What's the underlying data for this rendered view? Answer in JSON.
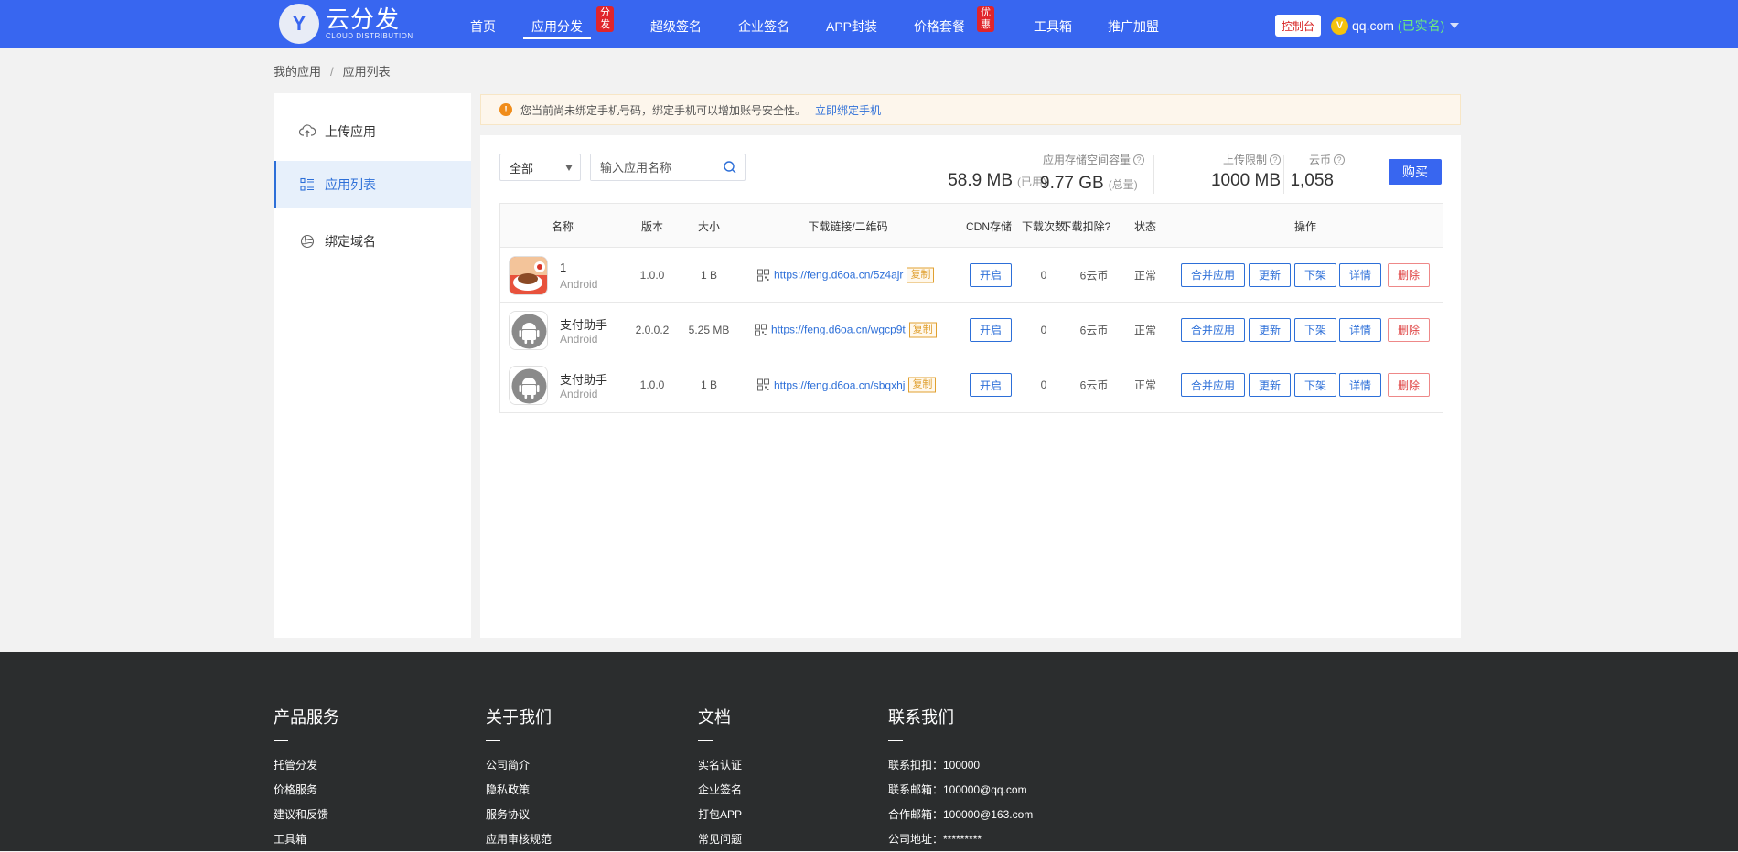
{
  "logo": {
    "badge": "Y",
    "name": "云分发",
    "subtitle": "CLOUD DISTRIBUTION"
  },
  "nav": {
    "items": [
      "首页",
      "应用分发",
      "超级签名",
      "企业签名",
      "APP封装",
      "价格套餐",
      "工具箱",
      "推广加盟"
    ],
    "active": "应用分发",
    "tags": {
      "distribute": "分发",
      "pricing": "优惠"
    }
  },
  "header": {
    "console_label": "控制台",
    "vip_badge": "V",
    "user_email": "qq.com",
    "verified_label": "(已实名)"
  },
  "breadcrumb": [
    "我的应用",
    "应用列表"
  ],
  "breadcrumb_sep": "/",
  "sidebar": {
    "items": [
      {
        "label": "上传应用",
        "icon": "upload-cloud-icon"
      },
      {
        "label": "应用列表",
        "icon": "list-icon"
      },
      {
        "label": "绑定域名",
        "icon": "globe-icon"
      }
    ],
    "active_index": 1
  },
  "notice": {
    "icon": "!",
    "text": "您当前尚未绑定手机号码，绑定手机可以增加账号安全性。",
    "link": "立即绑定手机"
  },
  "filter": {
    "selected": "全部",
    "search_placeholder": "输入应用名称"
  },
  "stats": {
    "storage_label": "应用存储空间容量",
    "used_value": "58.9 MB",
    "used_note": "(已用)",
    "total_value": "9.77 GB",
    "total_note": "(总量)",
    "upload_label": "上传限制",
    "upload_value": "1000 MB",
    "coin_label": "云币",
    "coin_value": "1,058",
    "help_icon": "?",
    "buy_label": "购买"
  },
  "table": {
    "headers": [
      "名称",
      "版本",
      "大小",
      "下载链接/二维码",
      "CDN存储",
      "下载次数",
      "下载扣除?",
      "状态",
      "操作"
    ],
    "copy_label": "复制",
    "actions": [
      "合并应用",
      "更新",
      "下架",
      "详情",
      "删除"
    ],
    "rows": [
      {
        "name": "1",
        "platform": "Android",
        "version": "1.0.0",
        "size": "1 B",
        "link": "https://feng.d6oa.cn/5z4ajr",
        "cdn": "开启",
        "downloads": "0",
        "deduct": "6云币",
        "status": "正常",
        "icon": "coffee-app-icon"
      },
      {
        "name": "支付助手",
        "platform": "Android",
        "version": "2.0.0.2",
        "size": "5.25 MB",
        "link": "https://feng.d6oa.cn/wgcp9t",
        "cdn": "开启",
        "downloads": "0",
        "deduct": "6云币",
        "status": "正常",
        "icon": "android-icon"
      },
      {
        "name": "支付助手",
        "platform": "Android",
        "version": "1.0.0",
        "size": "1 B",
        "link": "https://feng.d6oa.cn/sbqxhj",
        "cdn": "开启",
        "downloads": "0",
        "deduct": "6云币",
        "status": "正常",
        "icon": "android-icon"
      }
    ]
  },
  "footer": {
    "columns": [
      {
        "title": "产品服务",
        "links": [
          "托管分发",
          "价格服务",
          "建议和反馈",
          "工具箱"
        ]
      },
      {
        "title": "关于我们",
        "links": [
          "公司简介",
          "隐私政策",
          "服务协议",
          "应用审核规范"
        ]
      },
      {
        "title": "文档",
        "links": [
          "实名认证",
          "企业签名",
          "打包APP",
          "常见问题"
        ]
      },
      {
        "title": "联系我们",
        "links": [
          "联系扣扣：100000",
          "联系邮箱：100000@qq.com",
          "合作邮箱：100000@163.com",
          "公司地址：*********"
        ]
      }
    ]
  },
  "colors": {
    "primary": "#3866f0",
    "link": "#2d6fd8",
    "danger": "#e04848",
    "warning": "#e0a030",
    "footer_bg": "#2b2d2e"
  }
}
